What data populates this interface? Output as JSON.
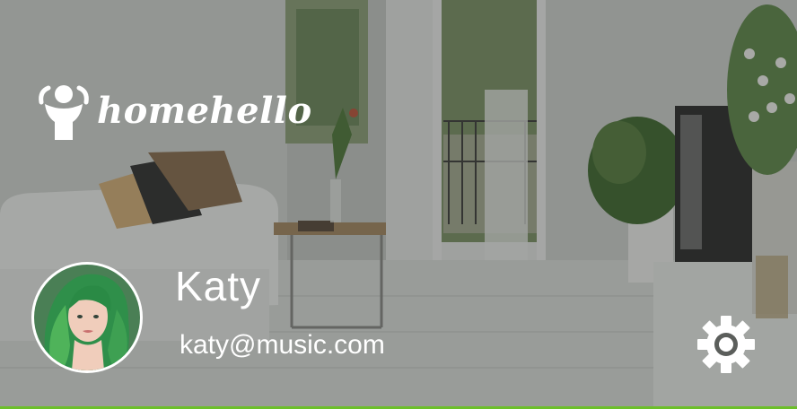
{
  "app": {
    "brand": "homehello"
  },
  "profile": {
    "name": "Katy",
    "email": "katy@music.com"
  },
  "icons": {
    "logo": "person-arms-up-icon",
    "settings": "gear-icon",
    "avatar": "user-avatar-photo"
  },
  "colors": {
    "accent": "#6cbf2a",
    "text": "#ffffff"
  }
}
